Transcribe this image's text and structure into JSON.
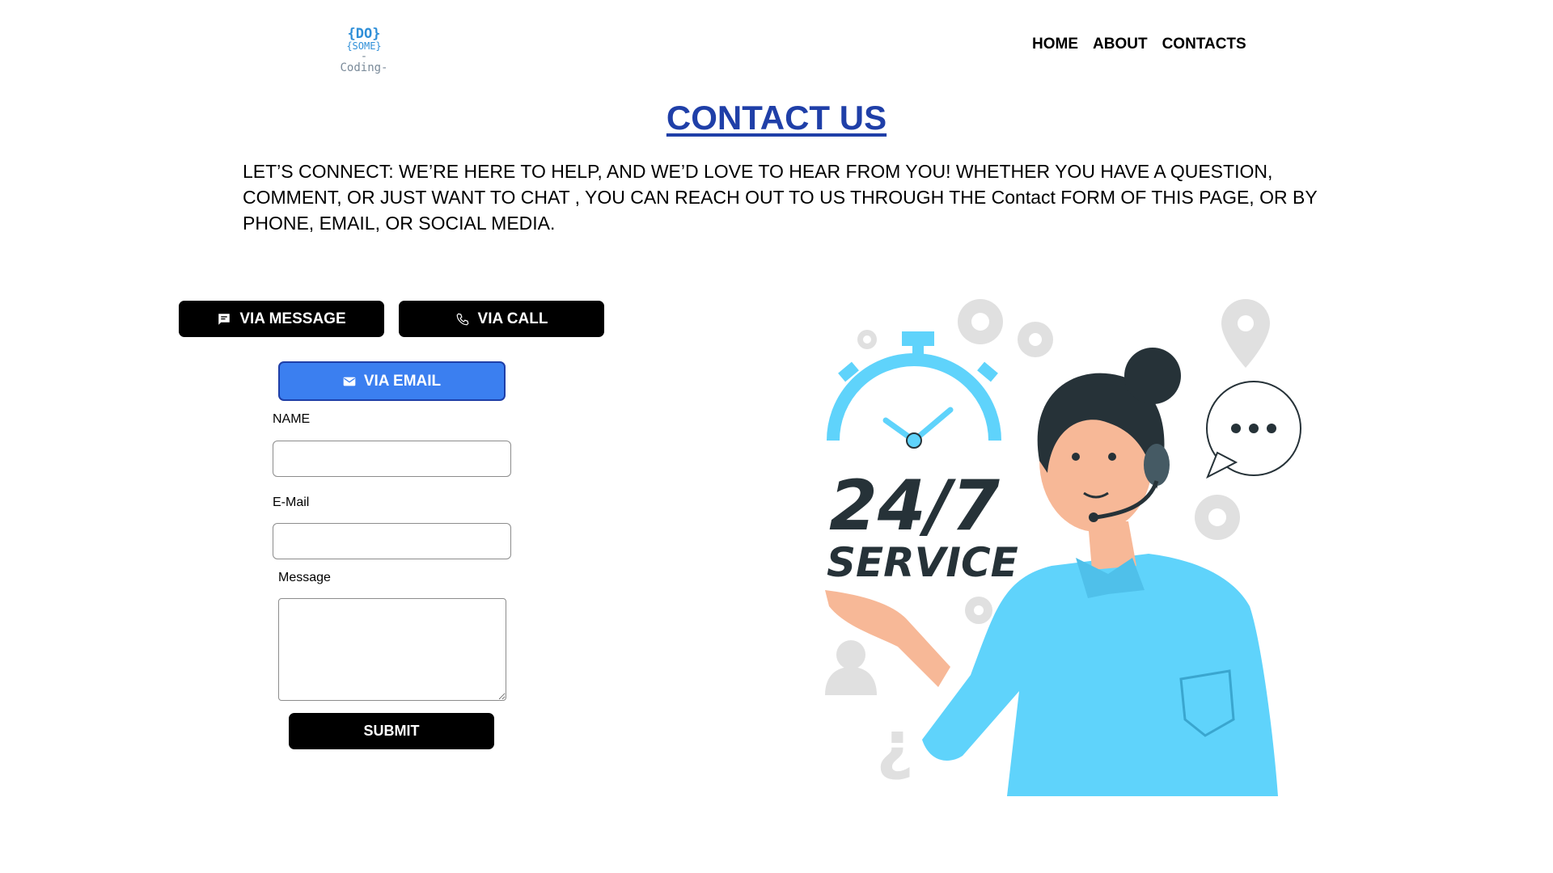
{
  "header": {
    "logo": {
      "line1": "{DO}",
      "line2": "{SOME}",
      "line3": "-Coding-"
    },
    "nav": [
      {
        "label": "HOME"
      },
      {
        "label": "ABOUT"
      },
      {
        "label": "CONTACTS"
      }
    ]
  },
  "main": {
    "title": "CONTACT US",
    "intro": "LET’S CONNECT: WE’RE HERE TO HELP, AND WE’D LOVE TO HEAR FROM YOU! WHETHER YOU HAVE A QUESTION, COMMENT, OR JUST WANT TO CHAT , YOU CAN REACH OUT TO US THROUGH THE Contact FORM OF THIS PAGE, OR BY PHONE, EMAIL, OR SOCIAL MEDIA."
  },
  "contact_options": {
    "message_label": "VIA MESSAGE",
    "call_label": "VIA CALL",
    "email_label": "VIA EMAIL"
  },
  "form": {
    "name_label": "NAME",
    "name_value": "",
    "email_label": "E-Mail",
    "email_value": "",
    "message_label": "Message",
    "message_value": "",
    "submit_label": "SUBMIT"
  },
  "illustration": {
    "line1": "24/7",
    "line2": "SERVICE"
  },
  "colors": {
    "title": "#1f3fa8",
    "accent_blue": "#3b7ff0",
    "illustration_blue": "#5fd3fb",
    "dark": "#263238"
  },
  "icons": {
    "message": "chat-bubble-icon",
    "call": "phone-icon",
    "email": "envelope-icon"
  }
}
